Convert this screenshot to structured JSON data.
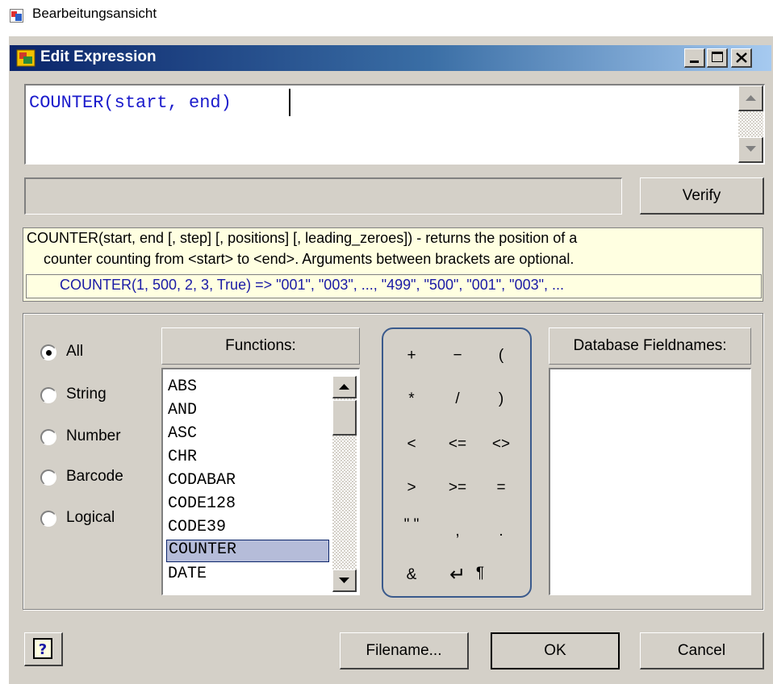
{
  "app": {
    "title": "Bearbeitungsansicht"
  },
  "dialog": {
    "title": "Edit Expression"
  },
  "expression": {
    "text": "COUNTER(start, end)"
  },
  "buttons": {
    "verify": "Verify",
    "filename": "Filename...",
    "ok": "OK",
    "cancel": "Cancel"
  },
  "help": {
    "line1": "COUNTER(start, end [, step] [, positions] [, leading_zeroes]) - returns the position of a",
    "line2": "counter counting from <start> to <end>. Arguments between brackets are optional.",
    "example": "COUNTER(1, 500, 2, 3, True) => \"001\", \"003\", ..., \"499\", \"500\",  \"001\", \"003\", ..."
  },
  "filters": [
    {
      "label": "All",
      "selected": true
    },
    {
      "label": "String",
      "selected": false
    },
    {
      "label": "Number",
      "selected": false
    },
    {
      "label": "Barcode",
      "selected": false
    },
    {
      "label": "Logical",
      "selected": false
    }
  ],
  "functions": {
    "header": "Functions:",
    "items": [
      "ABS",
      "AND",
      "ASC",
      "CHR",
      "CODABAR",
      "CODE128",
      "CODE39",
      "COUNTER",
      "DATE"
    ],
    "selected": "COUNTER"
  },
  "operators": [
    "+",
    "−",
    "(",
    "*",
    "/",
    ")",
    "<",
    "<=",
    "<>",
    ">",
    ">=",
    "=",
    "\" \"",
    ",",
    ".",
    "&",
    "↵",
    "¶"
  ],
  "database": {
    "header": "Database Fieldnames:"
  },
  "icons": {
    "app": "app-icon",
    "dialog": "dialog-icon",
    "help": "help-icon"
  },
  "colors": {
    "title_start": "#0a246a",
    "title_end": "#a6caf0",
    "expression_text": "#1b1bcc",
    "help_bg": "#ffffe1",
    "selection": "#b5bcd9"
  }
}
